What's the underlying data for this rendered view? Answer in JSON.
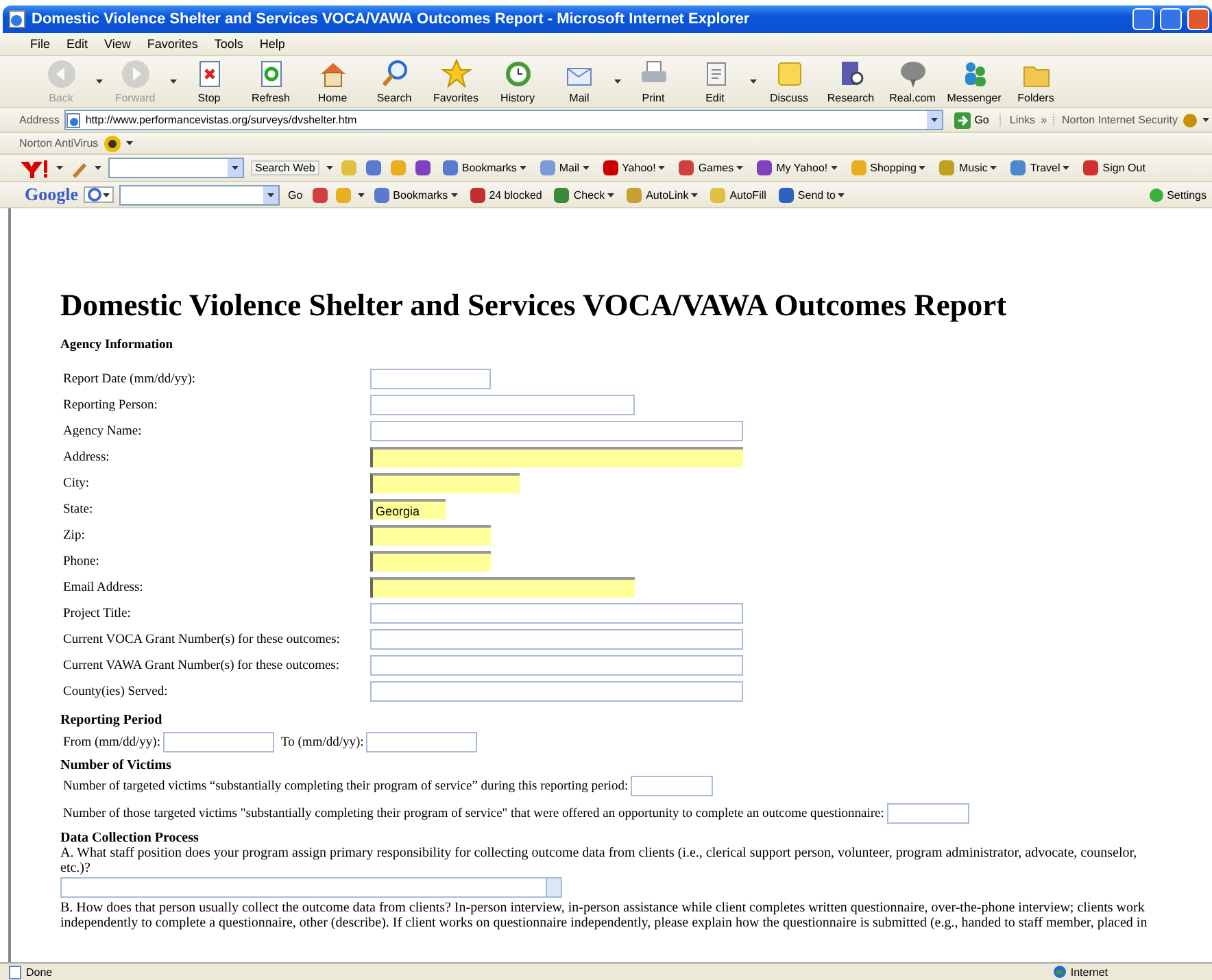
{
  "window": {
    "title": "Domestic Violence Shelter and Services VOCA/VAWA Outcomes Report - Microsoft Internet Explorer"
  },
  "menu": [
    "File",
    "Edit",
    "View",
    "Favorites",
    "Tools",
    "Help"
  ],
  "toolbar": [
    {
      "label": "Back",
      "kind": "back",
      "disabled": true,
      "dropdown": true
    },
    {
      "label": "Forward",
      "kind": "forward",
      "disabled": true,
      "dropdown": true
    },
    {
      "label": "Stop",
      "kind": "stop",
      "disabled": false,
      "dropdown": false
    },
    {
      "label": "Refresh",
      "kind": "refresh",
      "disabled": false,
      "dropdown": false
    },
    {
      "label": "Home",
      "kind": "home",
      "disabled": false,
      "dropdown": false
    },
    {
      "label": "Search",
      "kind": "search",
      "disabled": false,
      "dropdown": false
    },
    {
      "label": "Favorites",
      "kind": "favorites",
      "disabled": false,
      "dropdown": false
    },
    {
      "label": "History",
      "kind": "history",
      "disabled": false,
      "dropdown": false
    },
    {
      "label": "Mail",
      "kind": "mail",
      "disabled": false,
      "dropdown": true
    },
    {
      "label": "Print",
      "kind": "print",
      "disabled": false,
      "dropdown": false
    },
    {
      "label": "Edit",
      "kind": "edit",
      "disabled": false,
      "dropdown": true
    },
    {
      "label": "Discuss",
      "kind": "discuss",
      "disabled": false,
      "dropdown": false
    },
    {
      "label": "Research",
      "kind": "research",
      "disabled": false,
      "dropdown": false
    },
    {
      "label": "Real.com",
      "kind": "realcom",
      "disabled": false,
      "dropdown": false
    },
    {
      "label": "Messenger",
      "kind": "messenger",
      "disabled": false,
      "dropdown": false
    },
    {
      "label": "Folders",
      "kind": "folders",
      "disabled": false,
      "dropdown": false
    }
  ],
  "address": {
    "label": "Address",
    "value": "http://www.performancevistas.org/surveys/dvshelter.htm",
    "go": "Go",
    "links": "Links",
    "links_more": "»",
    "security": "Norton Internet Security"
  },
  "norton_bar": {
    "label": "Norton AntiVirus"
  },
  "yahoo_bar": {
    "search_button": "Search Web",
    "items": [
      {
        "label": "Bookmarks",
        "kind": "bookmarks"
      },
      {
        "label": "Mail",
        "kind": "mail"
      },
      {
        "label": "Yahoo!",
        "kind": "yahoo"
      },
      {
        "label": "Games",
        "kind": "games"
      },
      {
        "label": "My Yahoo!",
        "kind": "myyahoo"
      },
      {
        "label": "Shopping",
        "kind": "shopping"
      },
      {
        "label": "Music",
        "kind": "music"
      },
      {
        "label": "Travel",
        "kind": "travel"
      },
      {
        "label": "Sign Out",
        "kind": "signout"
      }
    ]
  },
  "google_bar": {
    "logo": "Google",
    "go": "Go",
    "items": [
      {
        "label": "Bookmarks",
        "kind": "bookmarks"
      },
      {
        "label": "24 blocked",
        "kind": "blocked"
      },
      {
        "label": "Check",
        "kind": "check"
      },
      {
        "label": "AutoLink",
        "kind": "autolink"
      },
      {
        "label": "AutoFill",
        "kind": "autofill"
      },
      {
        "label": "Send to",
        "kind": "sendto"
      }
    ],
    "settings": "Settings"
  },
  "page": {
    "heading": "Domestic Violence Shelter and Services VOCA/VAWA Outcomes Report",
    "agency": {
      "title": "Agency Information",
      "fields": [
        {
          "label": "Report Date (mm/dd/yy):",
          "kind": "short",
          "highlighted": false
        },
        {
          "label": "Reporting Person:",
          "kind": "medium",
          "highlighted": false
        },
        {
          "label": "Agency Name:",
          "kind": "long",
          "highlighted": false
        },
        {
          "label": "Address:",
          "kind": "long",
          "highlighted": true
        },
        {
          "label": "City:",
          "kind": "city",
          "highlighted": true
        },
        {
          "label": "State:",
          "kind": "tiny",
          "highlighted": true,
          "value": "Georgia"
        },
        {
          "label": "Zip:",
          "kind": "short",
          "highlighted": true
        },
        {
          "label": "Phone:",
          "kind": "short",
          "highlighted": true
        },
        {
          "label": "Email Address:",
          "kind": "medium",
          "highlighted": true
        },
        {
          "label": "Project Title:",
          "kind": "long",
          "highlighted": false
        },
        {
          "label": "Current VOCA Grant Number(s) for these outcomes:",
          "kind": "long",
          "highlighted": false
        },
        {
          "label": "Current VAWA Grant Number(s) for these outcomes:",
          "kind": "long",
          "highlighted": false
        },
        {
          "label": "County(ies) Served:",
          "kind": "long",
          "highlighted": false
        }
      ]
    },
    "reporting_period": {
      "title": "Reporting Period",
      "from_label": "From (mm/dd/yy):",
      "to_label": "To (mm/dd/yy):"
    },
    "victims": {
      "title": "Number of Victims",
      "questions": [
        "Number of targeted victims “substantially completing their program of service” during this reporting period:",
        "Number of those targeted victims \"substantially completing their program of service\" that were offered an opportunity to complete an outcome questionnaire:"
      ]
    },
    "data_collection": {
      "title": "Data Collection Process",
      "question_a": "A. What staff position does your program assign primary responsibility for collecting outcome data from clients (i.e., clerical support person, volunteer, program administrator, advocate, counselor, etc.)?",
      "question_b": "B. How does that person usually collect the outcome data from clients? In-person interview, in-person assistance while client completes written questionnaire, over-the-phone interview; clients work independently to complete a questionnaire, other (describe). If client works on questionnaire independently, please explain how the questionnaire is submitted (e.g., handed to staff member, placed in"
    }
  },
  "status_bar": {
    "text": "Done",
    "zone": "Internet"
  }
}
